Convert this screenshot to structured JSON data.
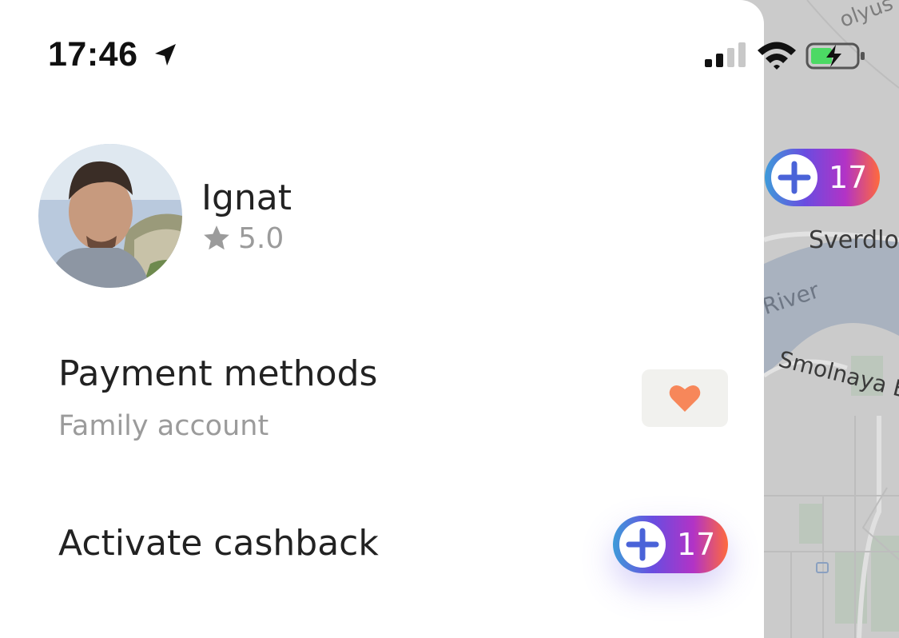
{
  "status_bar": {
    "time": "17:46",
    "icons": [
      "location-arrow-icon",
      "cellular-signal-icon",
      "wifi-icon",
      "battery-charging-icon"
    ]
  },
  "profile": {
    "name": "Ignat",
    "rating": "5.0",
    "rating_icon": "star-icon"
  },
  "menu": {
    "payment": {
      "title": "Payment methods",
      "subtitle": "Family account",
      "icon": "heart-icon",
      "icon_color": "#f7875a"
    },
    "cashback": {
      "title": "Activate cashback",
      "badge_count": "17",
      "badge_icon": "plus-icon"
    }
  },
  "map": {
    "plus_badge_count": "17",
    "labels": {
      "street_1": "Sverdlo",
      "river": "River",
      "street_2": "Smolnaya E",
      "top_fragment": "olyus"
    }
  },
  "colors": {
    "text_primary": "#222222",
    "text_secondary": "#9b9b9b",
    "heart": "#f7875a",
    "badge_gradient": [
      "#3e9bd9",
      "#6a4ce0",
      "#b233c6",
      "#ff6a3c"
    ]
  }
}
